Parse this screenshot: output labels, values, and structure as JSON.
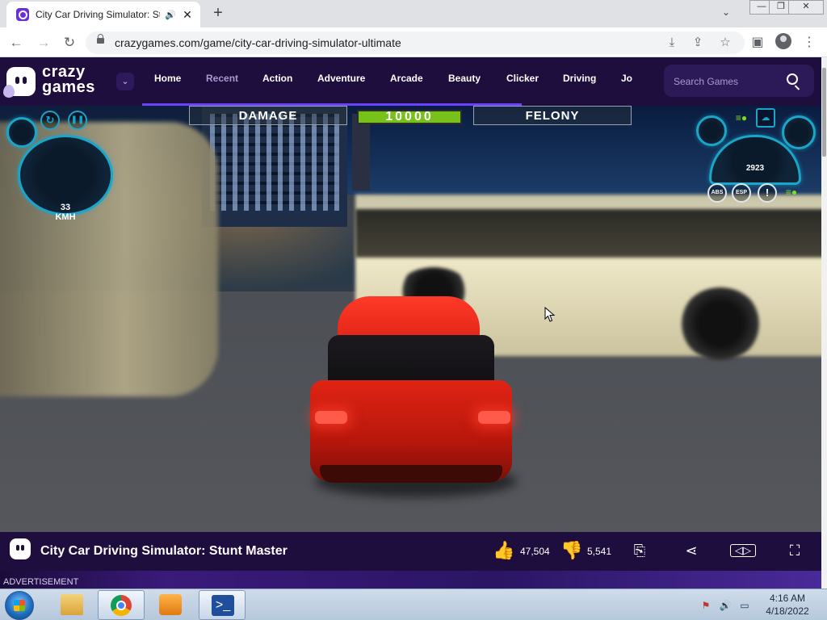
{
  "browser": {
    "tab_title": "City Car Driving Simulator: St",
    "audio_icon": "speaker-icon",
    "url": "crazygames.com/game/city-car-driving-simulator-ultimate"
  },
  "site": {
    "logo_line1": "crazy",
    "logo_line2": "games",
    "nav": [
      "Home",
      "Recent",
      "Action",
      "Adventure",
      "Arcade",
      "Beauty",
      "Clicker",
      "Driving",
      "Jo"
    ],
    "active_nav": "Recent",
    "search_placeholder": "Search Games",
    "accent_color": "#6842ff",
    "header_color": "#1d0e3d"
  },
  "game_hud": {
    "damage_label": "DAMAGE",
    "score": "10000",
    "felony_label": "FELONY",
    "speed_value": "33",
    "speed_unit": "KMH",
    "rpm_value": "2923",
    "button_abs": "ABS",
    "button_esp": "ESP",
    "button_warning": "!"
  },
  "game_info": {
    "title": "City Car Driving Simulator: Stunt Master",
    "likes": "47,504",
    "dislikes": "5,541"
  },
  "ad": {
    "label": "ADVERTISEMENT"
  },
  "taskbar": {
    "time": "4:16 AM",
    "date": "4/18/2022"
  }
}
